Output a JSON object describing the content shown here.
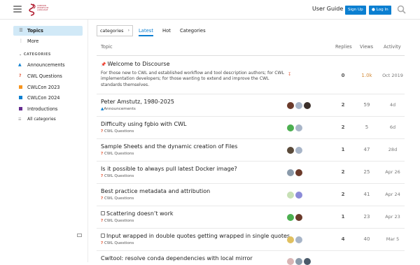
{
  "header": {
    "logo_text": [
      "COMMON",
      "WORKFLOW",
      "LANGUAGE"
    ],
    "user_guide": "User Guide",
    "signup": "Sign Up",
    "login": "Log In"
  },
  "sidebar": {
    "topics": "Topics",
    "more": "More",
    "categories_header": "CATEGORIES",
    "categories": [
      {
        "label": "Announcements",
        "color": "#0b7fd1"
      },
      {
        "label": "CWL Questions",
        "color": "#e45735"
      },
      {
        "label": "CWLCon 2023",
        "color": "#f7941d"
      },
      {
        "label": "CWLCon 2024",
        "color": "#0b7fd1"
      },
      {
        "label": "Introductions",
        "color": "#652d90"
      },
      {
        "label": "All categories",
        "color": "#888888"
      }
    ]
  },
  "nav": {
    "dropdown": "categories",
    "tabs": [
      "Latest",
      "Hot",
      "Categories"
    ]
  },
  "table": {
    "headers": {
      "topic": "Topic",
      "replies": "Replies",
      "views": "Views",
      "activity": "Activity"
    },
    "rows": [
      {
        "title": "Welcome to Discourse",
        "pinned": true,
        "excerpt": "For those new to CWL and established workflow and tool description authors; for CWL implementation developers; for those wanting to extend and improve the CWL standards themselves.",
        "replies": "0",
        "views": "1.0k",
        "activity": "Oct 2019"
      },
      {
        "title": "Peter Amstutz, 1980-2025",
        "category": "Announcements",
        "cat_color": "#0b7fd1",
        "replies": "2",
        "views": "59",
        "activity": "4d"
      },
      {
        "title": "Difficulty using fgbio with CWL",
        "category": "CWL Questions",
        "cat_color": "#e45735",
        "replies": "2",
        "views": "5",
        "activity": "6d"
      },
      {
        "title": "Sample Sheets and the dynamic creation of Files",
        "category": "CWL Questions",
        "cat_color": "#e45735",
        "replies": "1",
        "views": "47",
        "activity": "28d"
      },
      {
        "title": "Is it possible to always pull latest Docker image?",
        "category": "CWL Questions",
        "cat_color": "#e45735",
        "replies": "2",
        "views": "25",
        "activity": "Apr 26"
      },
      {
        "title": "Best practice metadata and attribution",
        "category": "CWL Questions",
        "cat_color": "#e45735",
        "replies": "2",
        "views": "41",
        "activity": "Apr 24"
      },
      {
        "title": "Scattering doesn’t work",
        "category": "CWL Questions",
        "cat_color": "#e45735",
        "solved": true,
        "replies": "1",
        "views": "23",
        "activity": "Apr 23"
      },
      {
        "title": "Input wrapped in double quotes getting wrapped in single quotes",
        "category": "CWL Questions",
        "cat_color": "#e45735",
        "solved": true,
        "replies": "4",
        "views": "40",
        "activity": "Mar 5"
      },
      {
        "title": "Cwltool: resolve conda dependencies with local mirror",
        "category": "",
        "cat_color": "#e45735",
        "replies": "",
        "views": "",
        "activity": ""
      }
    ]
  }
}
